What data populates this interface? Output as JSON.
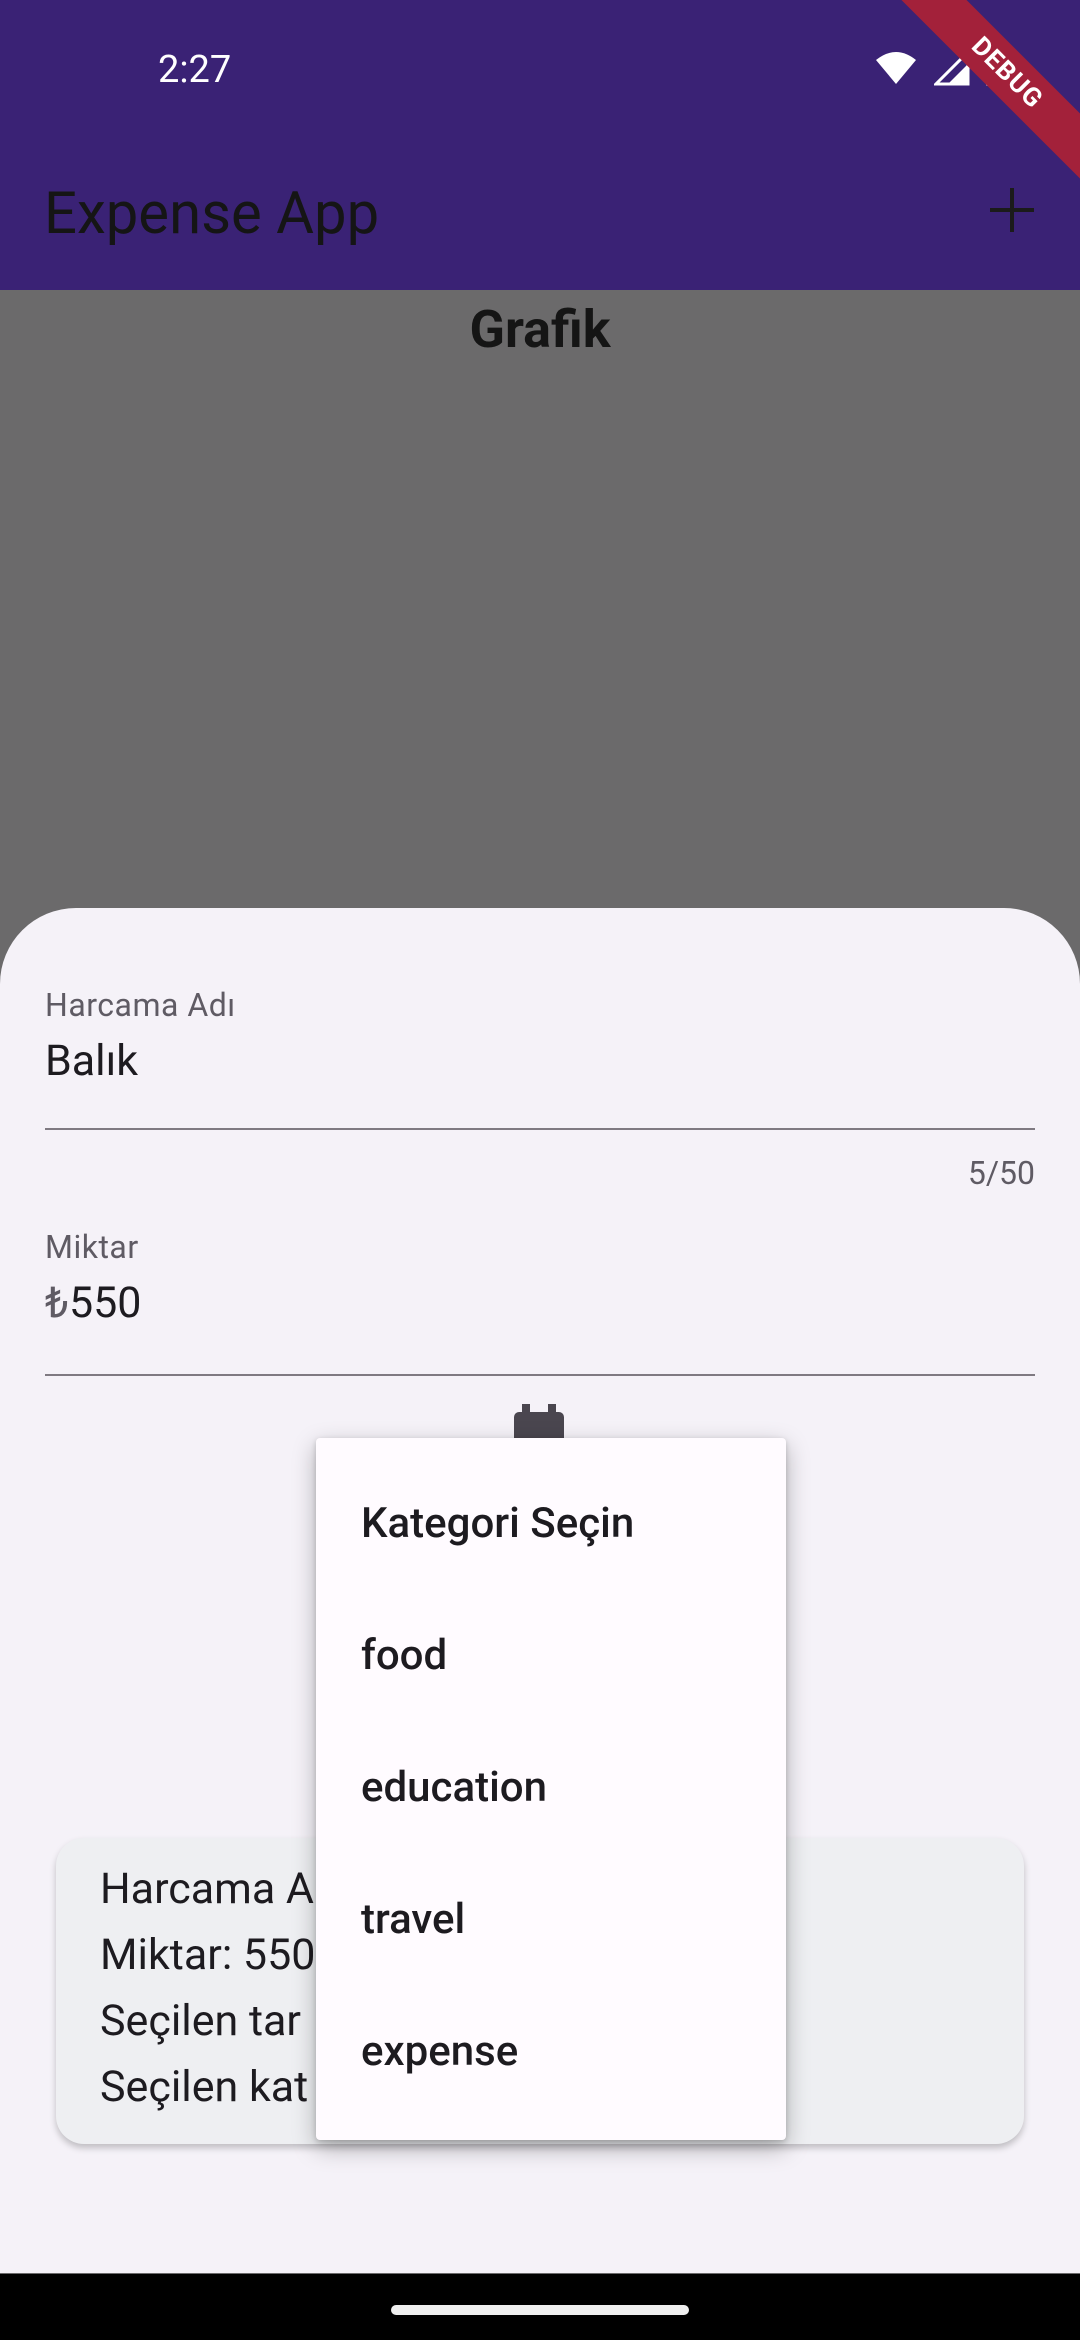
{
  "status_bar": {
    "time": "2:27"
  },
  "debug_banner": "DEBUG",
  "app_bar": {
    "title": "Expense App"
  },
  "main": {
    "title": "Grafik"
  },
  "form": {
    "name_label": "Harcama Adı",
    "name_value": "Balık",
    "name_counter": "5/50",
    "amount_label": "Miktar",
    "amount_prefix": "₺",
    "amount_value": "550"
  },
  "summary": {
    "lines": [
      "Harcama A",
      "Miktar: 550",
      "Seçilen tar",
      "Seçilen kat"
    ]
  },
  "dropdown": {
    "items": [
      "Kategori Seçin",
      "food",
      "education",
      "travel",
      "expense"
    ]
  },
  "colors": {
    "app_bar": "#3a2275",
    "scrim_background": "#6b6a6b",
    "sheet": "#f5f2f8",
    "debug_banner": "#a3213a"
  },
  "icons": [
    "wifi-icon",
    "signal-icon",
    "battery-icon",
    "add-icon",
    "calendar-icon"
  ]
}
